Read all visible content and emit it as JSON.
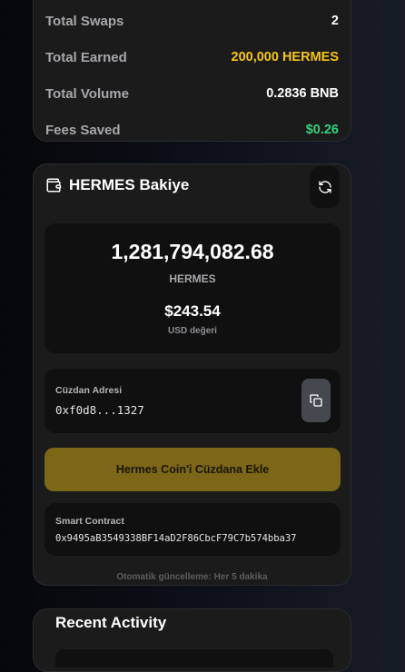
{
  "stats": {
    "rows": [
      {
        "label": "Total Swaps",
        "value": "2",
        "color": "#ffffff"
      },
      {
        "label": "Total Earned",
        "value": "200,000 HERMES",
        "color": "#f5c518"
      },
      {
        "label": "Total Volume",
        "value": "0.2836 BNB",
        "color": "#ffffff"
      },
      {
        "label": "Fees Saved",
        "value": "$0.26",
        "color": "#34d27b"
      }
    ]
  },
  "balance": {
    "title": "HERMES Bakiye",
    "wallet_icon": "wallet-icon",
    "refresh_icon": "refresh-icon",
    "amount": "1,281,794,082.68",
    "token": "HERMES",
    "usd_value": "$243.54",
    "usd_label": "USD değeri",
    "wallet_address_label": "Cüzdan Adresi",
    "wallet_address": "0xf0d8...1327",
    "copy_icon": "copy-icon",
    "add_button_label": "Hermes Coin'i Cüzdana Ekle",
    "contract_label": "Smart Contract",
    "contract_address": "0x9495aB3549338BF14aD2F86CbcF79C7b574bba37",
    "auto_update_note": "Otomatik güncelleme: Her 5 dakika"
  },
  "activity": {
    "title": "Recent Activity"
  },
  "colors": {
    "accent_gold": "#7c6618",
    "earned_yellow": "#f5c518",
    "saved_green": "#34d27b"
  }
}
